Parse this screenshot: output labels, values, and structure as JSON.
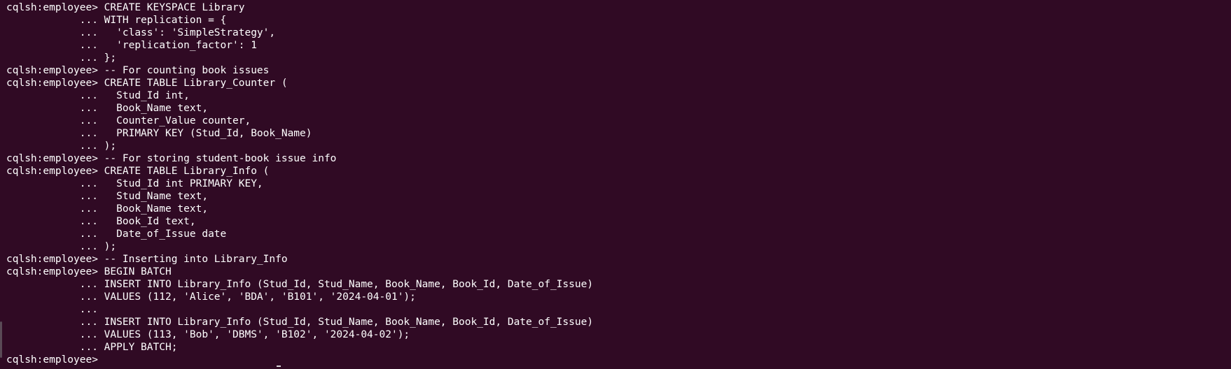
{
  "terminal": {
    "lines": [
      "cqlsh:employee> CREATE KEYSPACE Library",
      "            ... WITH replication = {",
      "            ...   'class': 'SimpleStrategy',",
      "            ...   'replication_factor': 1",
      "            ... };",
      "cqlsh:employee> -- For counting book issues",
      "cqlsh:employee> CREATE TABLE Library_Counter (",
      "            ...   Stud_Id int,",
      "            ...   Book_Name text,",
      "            ...   Counter_Value counter,",
      "            ...   PRIMARY KEY (Stud_Id, Book_Name)",
      "            ... );",
      "cqlsh:employee> -- For storing student-book issue info",
      "cqlsh:employee> CREATE TABLE Library_Info (",
      "            ...   Stud_Id int PRIMARY KEY,",
      "            ...   Stud_Name text,",
      "            ...   Book_Name text,",
      "            ...   Book_Id text,",
      "            ...   Date_of_Issue date",
      "            ... );",
      "cqlsh:employee> -- Inserting into Library_Info",
      "cqlsh:employee> BEGIN BATCH",
      "            ... INSERT INTO Library_Info (Stud_Id, Stud_Name, Book_Name, Book_Id, Date_of_Issue)",
      "            ... VALUES (112, 'Alice', 'BDA', 'B101', '2024-04-01');",
      "            ...",
      "            ... INSERT INTO Library_Info (Stud_Id, Stud_Name, Book_Name, Book_Id, Date_of_Issue)",
      "            ... VALUES (113, 'Bob', 'DBMS', 'B102', '2024-04-02');",
      "            ... APPLY BATCH;",
      "cqlsh:employee>"
    ]
  },
  "colors": {
    "background": "#300a24",
    "text": "#ffffff"
  }
}
